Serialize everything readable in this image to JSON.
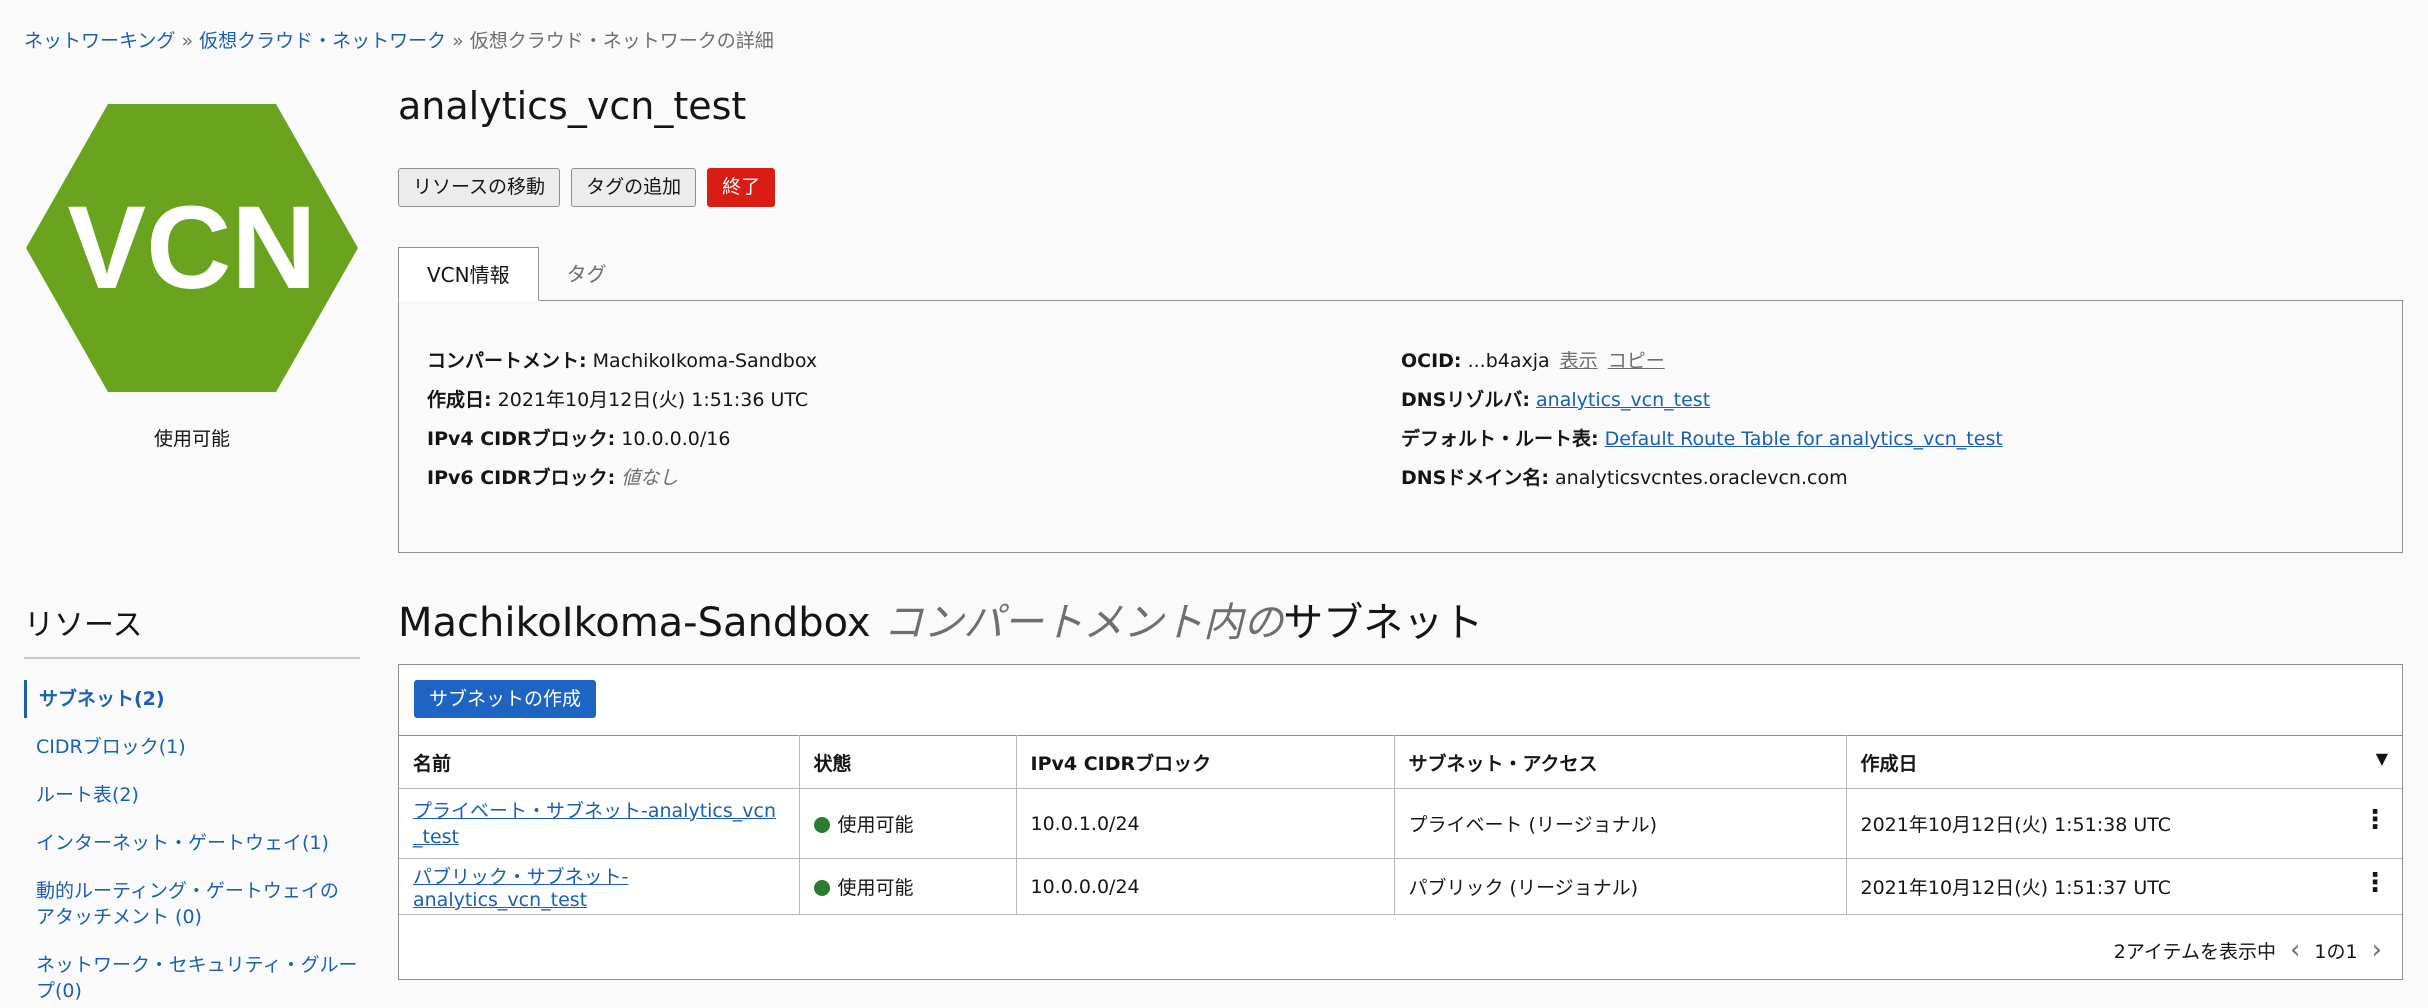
{
  "breadcrumb": {
    "items": [
      "ネットワーキング",
      "仮想クラウド・ネットワーク"
    ],
    "current": "仮想クラウド・ネットワークの詳細",
    "separator": "»"
  },
  "logo": {
    "text": "VCN",
    "color": "#6aa31d"
  },
  "status": "使用可能",
  "title": "analytics_vcn_test",
  "actions": {
    "move": "リソースの移動",
    "add_tag": "タグの追加",
    "terminate": "終了"
  },
  "tabs": [
    "VCN情報",
    "タグ"
  ],
  "info": {
    "compartment_k": "コンパートメント:",
    "compartment_v": "MachikoIkoma-Sandbox",
    "created_k": "作成日:",
    "created_v": "2021年10月12日(火) 1:51:36 UTC",
    "ipv4_k": "IPv4 CIDRブロック:",
    "ipv4_v": "10.0.0.0/16",
    "ipv6_k": "IPv6 CIDRブロック:",
    "ipv6_v": "値なし",
    "ocid_k": "OCID:",
    "ocid_v": "...b4axja",
    "ocid_show": "表示",
    "ocid_copy": "コピー",
    "dns_resolver_k": "DNSリゾルバ:",
    "dns_resolver_v": "analytics_vcn_test",
    "route_k": "デフォルト・ルート表:",
    "route_v": "Default Route Table for analytics_vcn_test",
    "dns_domain_k": "DNSドメイン名:",
    "dns_domain_v": "analyticsvcntes.oraclevcn.com"
  },
  "resources": {
    "title": "リソース",
    "items": [
      "サブネット(2)",
      "CIDRブロック(1)",
      "ルート表(2)",
      "インターネット・ゲートウェイ(1)",
      "動的ルーティング・ゲートウェイの アタッチメント (0)",
      "ネットワーク・セキュリティ・グループ(0)"
    ]
  },
  "subnets": {
    "title_compartment": "MachikoIkoma-Sandbox",
    "title_mid": "コンパートメント内の",
    "title_end": "サブネット",
    "create_button": "サブネットの作成",
    "columns": [
      "名前",
      "状態",
      "IPv4 CIDRブロック",
      "サブネット・アクセス",
      "作成日"
    ],
    "rows": [
      {
        "name": "プライベート・サブネット-analytics_vcn_test",
        "state": "使用可能",
        "cidr": "10.0.1.0/24",
        "access": "プライベート (リージョナル)",
        "created": "2021年10月12日(火) 1:51:38 UTC"
      },
      {
        "name": "パブリック・サブネット-analytics_vcn_test",
        "state": "使用可能",
        "cidr": "10.0.0.0/24",
        "access": "パブリック (リージョナル)",
        "created": "2021年10月12日(火) 1:51:37 UTC"
      }
    ],
    "footer_count": "2アイテムを表示中",
    "page": "1の1"
  }
}
